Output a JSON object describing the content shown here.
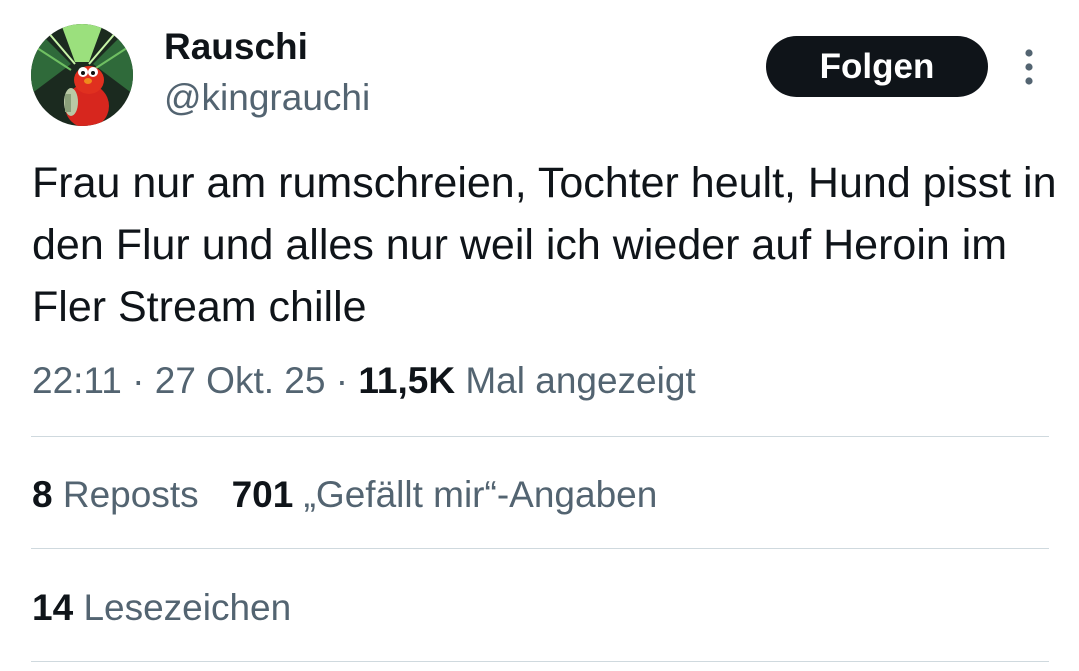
{
  "author": {
    "display_name": "Rauschi",
    "handle": "@kingrauchi",
    "avatar_icon": "elmo-avatar-icon"
  },
  "actions": {
    "follow_label": "Folgen",
    "more_icon": "more-dots-vertical-icon"
  },
  "tweet": {
    "text": "Frau nur am rumschreien, Tochter heult, Hund pisst in den Flur und alles nur weil ich wieder auf Heroin im Fler Stream chille",
    "time": "22:11",
    "separator": "·",
    "date": "27 Okt. 25",
    "views_count": "11,5K",
    "views_label": "Mal angezeigt"
  },
  "stats": {
    "reposts_count": "8",
    "reposts_label": "Reposts",
    "likes_count": "701",
    "likes_label": "„Gefällt mir“-Angaben",
    "bookmarks_count": "14",
    "bookmarks_label": "Lesezeichen"
  },
  "colors": {
    "text_primary": "#0f1419",
    "text_secondary": "#536471",
    "divider": "#cfd9de",
    "button_bg": "#0f1419",
    "button_text": "#ffffff"
  }
}
